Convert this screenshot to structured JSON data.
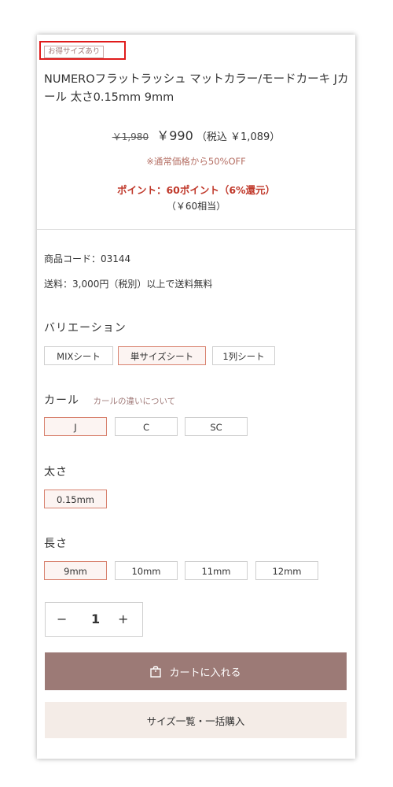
{
  "product": {
    "tag": "お得サイズあり",
    "title": "NUMEROフラットラッシュ マットカラー/モードカーキ Jカール 太さ0.15mm 9mm",
    "price_old": "￥1,980",
    "price_new": "￥990",
    "price_tax": "（税込 ￥1,089）",
    "discount_note": "※通常価格から50%OFF",
    "points": "ポイント：60ポイント（6%還元）",
    "points_equiv": "（￥60相当）",
    "code": "商品コード：03144",
    "shipping": "送料：3,000円（税別）以上で送料無料"
  },
  "variation": {
    "label": "バリエーション",
    "options": [
      "MIXシート",
      "単サイズシート",
      "1列シート"
    ],
    "selected": "単サイズシート"
  },
  "curl": {
    "label": "カール",
    "link": "カールの違いについて",
    "options": [
      "J",
      "C",
      "SC"
    ],
    "selected": "J"
  },
  "thickness": {
    "label": "太さ",
    "options": [
      "0.15mm"
    ],
    "selected": "0.15mm"
  },
  "length": {
    "label": "長さ",
    "options": [
      "9mm",
      "10mm",
      "11mm",
      "12mm"
    ],
    "selected": "9mm"
  },
  "quantity": {
    "minus": "−",
    "value": "1",
    "plus": "+"
  },
  "actions": {
    "cart_label": "カートに入れる",
    "cart_icon": "shopping-bag-icon",
    "size_list_label": "サイズ一覧・一括購入"
  },
  "colors": {
    "accent_border": "#d8826f",
    "cart_button": "#9c7a76",
    "size_button": "#f4ece7",
    "points_red": "#c0392b",
    "highlight_red": "#e01b1b"
  }
}
